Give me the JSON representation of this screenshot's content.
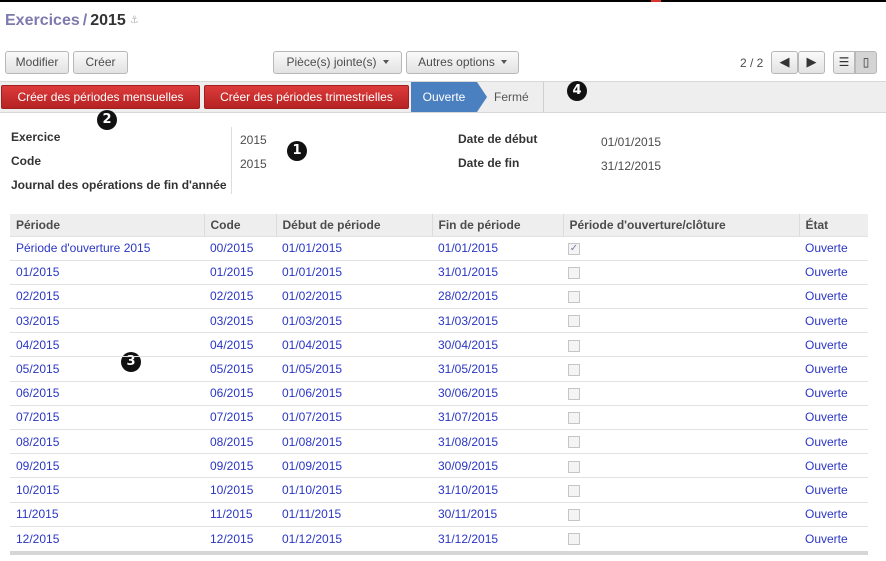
{
  "breadcrumb": {
    "parent": "Exercices",
    "separator": "/",
    "current": "2015"
  },
  "toolbar": {
    "edit": "Modifier",
    "create": "Créer",
    "attachments": "Pièce(s) jointe(s)",
    "more": "Autres options"
  },
  "pager": {
    "text": "2 / 2"
  },
  "statusbar": {
    "monthly": "Créer des périodes mensuelles",
    "quarterly": "Créer des périodes trimestrielles",
    "stages": [
      "Ouverte",
      "Fermé"
    ],
    "active_stage": "Ouverte"
  },
  "markers": [
    "1",
    "2",
    "3",
    "4"
  ],
  "form": {
    "fiscal_year_label": "Exercice",
    "fiscal_year_value": "2015",
    "code_label": "Code",
    "code_value": "2015",
    "journal_label": "Journal des opérations de fin d'année",
    "journal_value": "",
    "start_label": "Date de début",
    "start_value": "01/01/2015",
    "end_label": "Date de fin",
    "end_value": "31/12/2015"
  },
  "table": {
    "columns": [
      "Période",
      "Code",
      "Début de période",
      "Fin de période",
      "Période d'ouverture/clôture",
      "État"
    ],
    "rows": [
      {
        "period": "Période d'ouverture 2015",
        "code": "00/2015",
        "start": "01/01/2015",
        "end": "01/01/2015",
        "opening": true,
        "state": "Ouverte"
      },
      {
        "period": "01/2015",
        "code": "01/2015",
        "start": "01/01/2015",
        "end": "31/01/2015",
        "opening": false,
        "state": "Ouverte"
      },
      {
        "period": "02/2015",
        "code": "02/2015",
        "start": "01/02/2015",
        "end": "28/02/2015",
        "opening": false,
        "state": "Ouverte"
      },
      {
        "period": "03/2015",
        "code": "03/2015",
        "start": "01/03/2015",
        "end": "31/03/2015",
        "opening": false,
        "state": "Ouverte"
      },
      {
        "period": "04/2015",
        "code": "04/2015",
        "start": "01/04/2015",
        "end": "30/04/2015",
        "opening": false,
        "state": "Ouverte"
      },
      {
        "period": "05/2015",
        "code": "05/2015",
        "start": "01/05/2015",
        "end": "31/05/2015",
        "opening": false,
        "state": "Ouverte"
      },
      {
        "period": "06/2015",
        "code": "06/2015",
        "start": "01/06/2015",
        "end": "30/06/2015",
        "opening": false,
        "state": "Ouverte"
      },
      {
        "period": "07/2015",
        "code": "07/2015",
        "start": "01/07/2015",
        "end": "31/07/2015",
        "opening": false,
        "state": "Ouverte"
      },
      {
        "period": "08/2015",
        "code": "08/2015",
        "start": "01/08/2015",
        "end": "31/08/2015",
        "opening": false,
        "state": "Ouverte"
      },
      {
        "period": "09/2015",
        "code": "09/2015",
        "start": "01/09/2015",
        "end": "30/09/2015",
        "opening": false,
        "state": "Ouverte"
      },
      {
        "period": "10/2015",
        "code": "10/2015",
        "start": "01/10/2015",
        "end": "31/10/2015",
        "opening": false,
        "state": "Ouverte"
      },
      {
        "period": "11/2015",
        "code": "11/2015",
        "start": "01/11/2015",
        "end": "30/11/2015",
        "opening": false,
        "state": "Ouverte"
      },
      {
        "period": "12/2015",
        "code": "12/2015",
        "start": "01/12/2015",
        "end": "31/12/2015",
        "opening": false,
        "state": "Ouverte"
      }
    ]
  }
}
